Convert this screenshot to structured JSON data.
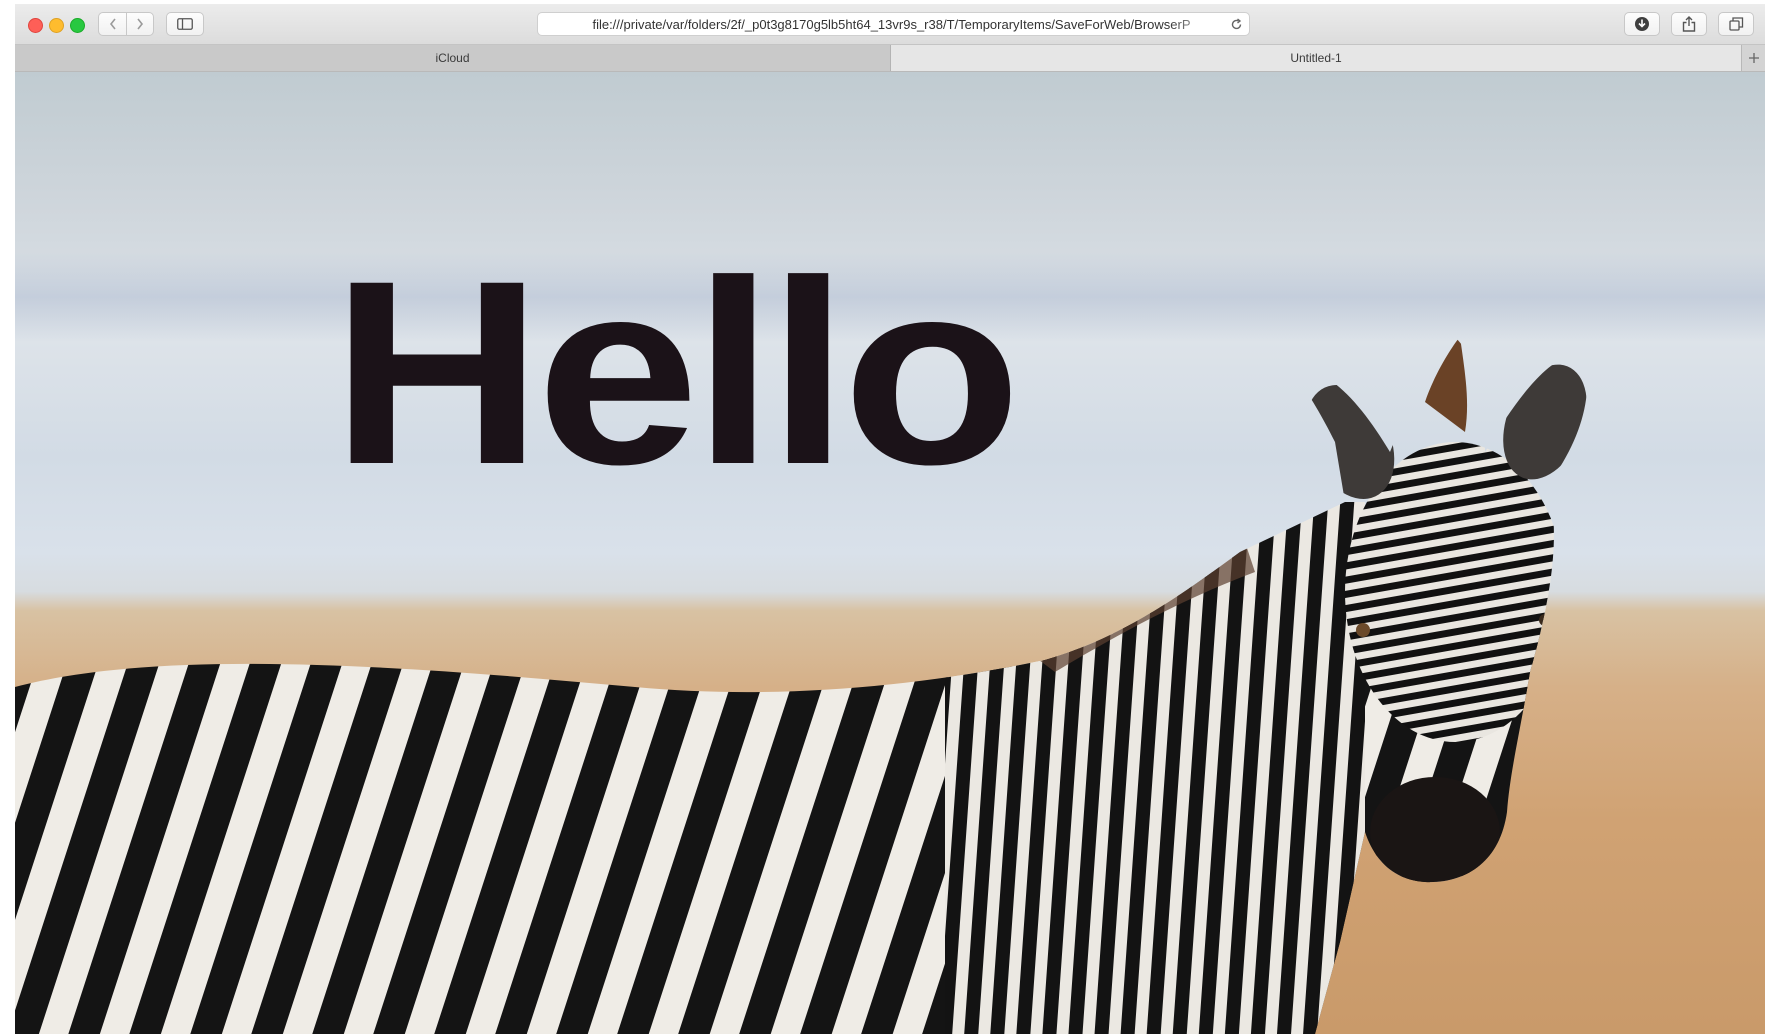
{
  "toolbar": {
    "url": "file:///private/var/folders/2f/_p0t3g8170g5lb5ht64_13vr9s_r38/T/TemporaryItems/SaveForWeb/BrowserP",
    "buttons": [
      "close",
      "minimize",
      "zoom",
      "back",
      "forward",
      "sidebar",
      "reload",
      "downloads",
      "share",
      "tabs-overview"
    ]
  },
  "tabs": [
    {
      "label": "iCloud",
      "active": false
    },
    {
      "label": "Untitled-1",
      "active": true
    }
  ],
  "content": {
    "heading": "Hello",
    "heading_color": "#1b1218",
    "background": "zebra-savanna-photo"
  },
  "colors": {
    "close": "#fe5f57",
    "minimize": "#febc2e",
    "zoom": "#28c840"
  }
}
